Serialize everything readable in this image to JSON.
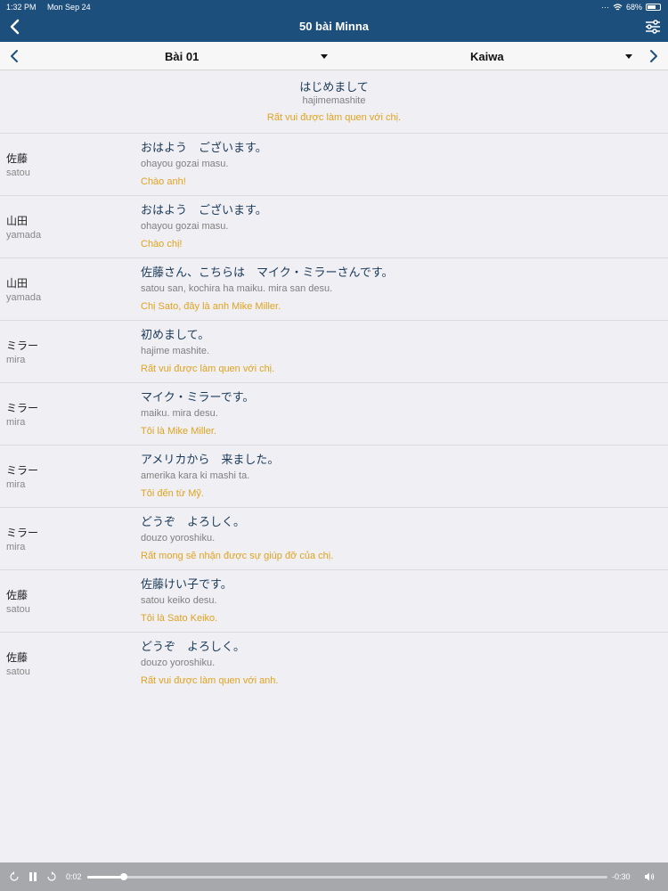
{
  "status": {
    "time": "1:32 PM",
    "date": "Mon Sep 24",
    "battery": "68%"
  },
  "header": {
    "title": "50 bài Minna"
  },
  "selector": {
    "lesson": "Bài 01",
    "type": "Kaiwa"
  },
  "intro": {
    "japanese": "はじめまして",
    "romaji": "hajimemashite",
    "vietnamese": "Rất vui được làm quen với chị."
  },
  "dialogue": [
    {
      "speaker": "佐藤",
      "speaker_romaji": "satou",
      "japanese": "おはよう　ございます。",
      "romaji": "ohayou gozai masu.",
      "vietnamese": "Chào anh!"
    },
    {
      "speaker": "山田",
      "speaker_romaji": "yamada",
      "japanese": "おはよう　ございます。",
      "romaji": "ohayou gozai masu.",
      "vietnamese": "Chào chị!"
    },
    {
      "speaker": "山田",
      "speaker_romaji": "yamada",
      "japanese": "佐藤さん、こちらは　マイク・ミラーさんです。",
      "romaji": "satou san, kochira ha maiku. mira san desu.",
      "vietnamese": "Chị Sato, đây là anh Mike Miller."
    },
    {
      "speaker": "ミラー",
      "speaker_romaji": "mira",
      "japanese": "初めまして。",
      "romaji": "hajime mashite.",
      "vietnamese": "Rất vui được làm quen với chị."
    },
    {
      "speaker": "ミラー",
      "speaker_romaji": "mira",
      "japanese": "マイク・ミラーです。",
      "romaji": "maiku. mira desu.",
      "vietnamese": "Tôi là Mike Miller."
    },
    {
      "speaker": "ミラー",
      "speaker_romaji": "mira",
      "japanese": "アメリカから　来ました。",
      "romaji": "amerika kara ki mashi ta.",
      "vietnamese": "Tôi đến từ Mỹ."
    },
    {
      "speaker": "ミラー",
      "speaker_romaji": "mira",
      "japanese": "どうぞ　よろしく。",
      "romaji": "douzo yoroshiku.",
      "vietnamese": "Rất mong sẽ nhận được sự giúp đỡ của chị."
    },
    {
      "speaker": "佐藤",
      "speaker_romaji": "satou",
      "japanese": "佐藤けい子です。",
      "romaji": "satou keiko desu.",
      "vietnamese": "Tôi là Sato Keiko."
    },
    {
      "speaker": "佐藤",
      "speaker_romaji": "satou",
      "japanese": "どうぞ　よろしく。",
      "romaji": "douzo yoroshiku.",
      "vietnamese": "Rất vui được làm quen với anh."
    }
  ],
  "player": {
    "elapsed": "0:02",
    "remaining": "-0:30",
    "progress_fraction": 0.07
  },
  "colors": {
    "header": "#1d4f7c",
    "accent": "#e0a31f",
    "japanese_text": "#1b3a57"
  }
}
